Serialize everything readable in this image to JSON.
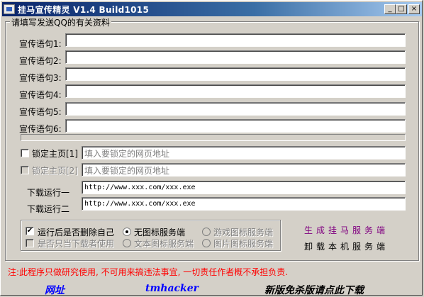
{
  "window": {
    "title": "挂马宣传精灵 V1.4  Build1015",
    "min_glyph": "_",
    "max_glyph": "□",
    "close_glyph": "×"
  },
  "group_qq": {
    "legend": "请填写发送QQ的有关资料",
    "slogans": [
      {
        "label": "宣传语句1:",
        "value": ""
      },
      {
        "label": "宣传语句2:",
        "value": ""
      },
      {
        "label": "宣传语句3:",
        "value": ""
      },
      {
        "label": "宣传语句4:",
        "value": ""
      },
      {
        "label": "宣传语句5:",
        "value": ""
      },
      {
        "label": "宣传语句6:",
        "value": ""
      }
    ]
  },
  "lock_home": [
    {
      "label": "锁定主页[1]",
      "placeholder": "填入要锁定的网页地址",
      "checked": false,
      "enabled": true
    },
    {
      "label": "锁定主页[2]",
      "placeholder": "填入要锁定的网页地址",
      "checked": false,
      "enabled": false
    }
  ],
  "downloads": [
    {
      "label": "下载运行一",
      "value": "http://www.xxx.com/xxx.exe"
    },
    {
      "label": "下载运行二",
      "value": "http://www.xxx.com/xxx.exe"
    }
  ],
  "options": {
    "delete_self": {
      "label": "运行后是否删除自己",
      "checked": true
    },
    "only_downloader": {
      "label": "是否只当下载者使用",
      "checked": false
    },
    "radios": [
      {
        "label": "无图标服务端",
        "selected": true,
        "enabled": true
      },
      {
        "label": "游戏图标服务端",
        "selected": false,
        "enabled": false
      },
      {
        "label": "文本图标服务端",
        "selected": false,
        "enabled": false
      },
      {
        "label": "图片图标服务端",
        "selected": false,
        "enabled": false
      }
    ],
    "check_mark": "✔"
  },
  "actions": {
    "generate_label": "生成挂马服务端",
    "uninstall_label": "卸载本机服务端"
  },
  "notice": "注:此程序只做研究使用, 不可用来搞违法事宜, 一切责任作者概不承担负责.",
  "footer": {
    "url_label": "网址",
    "author": "tmhacker",
    "download_label": "新版免杀版请点此下载"
  },
  "colors": {
    "title_start": "#0a246a",
    "title_end": "#a6caf0",
    "generate": "#800080",
    "notice": "#ff0000",
    "link": "#0000ff"
  }
}
